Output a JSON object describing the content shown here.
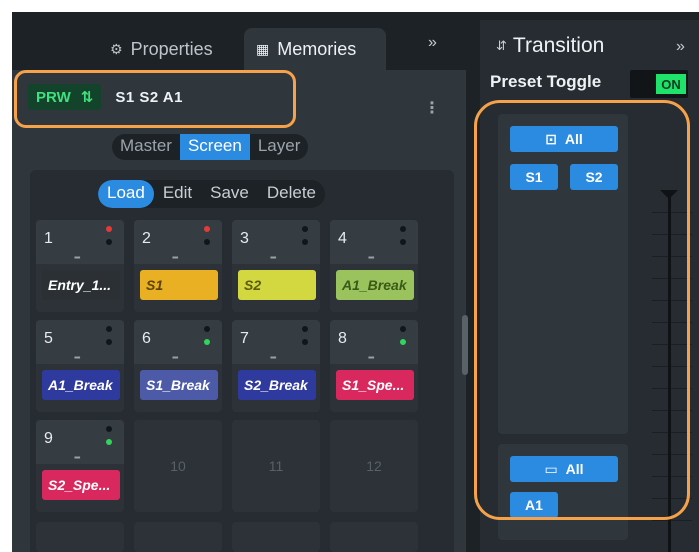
{
  "tabs": {
    "properties_label": "Properties",
    "memories_label": "Memories",
    "collapse_symbol": "»"
  },
  "memories": {
    "prw_label": "PRW",
    "prw_icon": "swap-arrows-icon",
    "prw_targets": "S1 S2 A1",
    "more_symbol": "⋮",
    "scope_options": [
      "Master",
      "Screen",
      "Layer"
    ],
    "scope_active": "Screen",
    "actions": [
      "Load",
      "Edit",
      "Save",
      "Delete"
    ],
    "action_active": "Load",
    "cells": [
      {
        "num": "1",
        "label": "Entry_1...",
        "color": "#2b3035",
        "text_color": "#ffffff",
        "status": "red"
      },
      {
        "num": "2",
        "label": "S1",
        "color": "#e8b022",
        "text_color": "#5b4306",
        "status": "red"
      },
      {
        "num": "3",
        "label": "S2",
        "color": "#d4d840",
        "text_color": "#5a5d0c",
        "status": "none"
      },
      {
        "num": "4",
        "label": "A1_Break",
        "color": "#9bc35d",
        "text_color": "#3a5a18",
        "status": "none"
      },
      {
        "num": "5",
        "label": "A1_Break",
        "color": "#2f3a9e",
        "text_color": "#ffffff",
        "status": "none"
      },
      {
        "num": "6",
        "label": "S1_Break",
        "color": "#4c5aa8",
        "text_color": "#ffffff",
        "status": "green"
      },
      {
        "num": "7",
        "label": "S2_Break",
        "color": "#2f3a9e",
        "text_color": "#ffffff",
        "status": "none"
      },
      {
        "num": "8",
        "label": "S1_Spe...",
        "color": "#d8285e",
        "text_color": "#ffffff",
        "status": "green"
      },
      {
        "num": "9",
        "label": "S2_Spe...",
        "color": "#d8285e",
        "text_color": "#ffffff",
        "status": "green"
      }
    ],
    "empty_cells": [
      "10",
      "11",
      "12"
    ]
  },
  "transition": {
    "title": "Transition",
    "collapse_symbol": "»",
    "preset_toggle_label": "Preset Toggle",
    "toggle_state": "ON",
    "screen_group": {
      "all_label": "All",
      "icon": "screen-layout-icon",
      "items": [
        "S1",
        "S2"
      ]
    },
    "aux_group": {
      "all_label": "All",
      "icon": "monitor-icon",
      "items": [
        "A1"
      ]
    }
  },
  "colors": {
    "accent": "#2a8be0",
    "highlight": "#f5a24a",
    "on_green": "#1fe26b"
  }
}
